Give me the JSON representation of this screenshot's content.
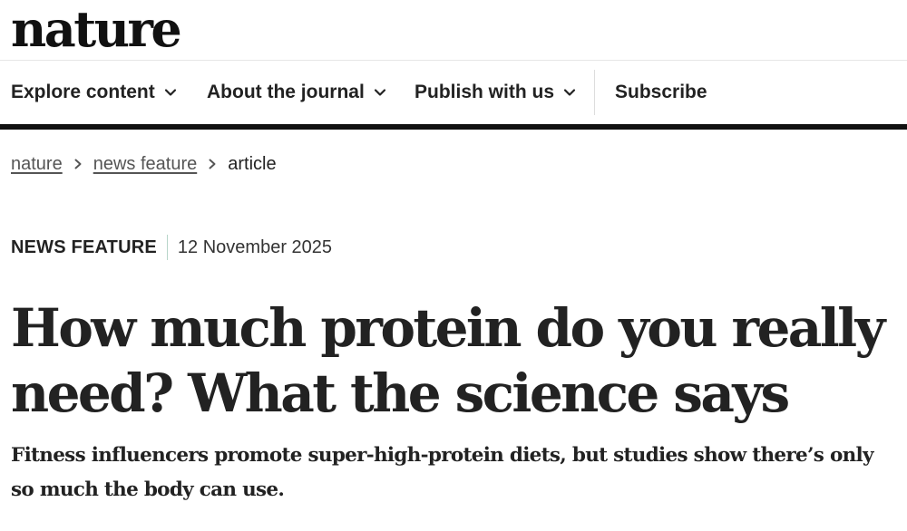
{
  "site": {
    "logo_text": "nature"
  },
  "nav": {
    "items": [
      {
        "label": "Explore content",
        "icon": "chevron-down-icon"
      },
      {
        "label": "About the journal",
        "icon": "chevron-down-icon"
      },
      {
        "label": "Publish with us",
        "icon": "chevron-down-icon"
      }
    ],
    "subscribe_label": "Subscribe"
  },
  "breadcrumb": {
    "items": [
      "nature",
      "news feature",
      "article"
    ],
    "separator_icon": "chevron-right-icon"
  },
  "article": {
    "type": "NEWS FEATURE",
    "date": "12 November 2025",
    "title": "How much protein do you really need? What the science says",
    "standfirst": "Fitness influencers promote super-high-protein diets, but studies show there’s only so much the body can use."
  },
  "colors": {
    "text": "#222222",
    "nav_bar": "#111111",
    "meta_divider": "#b7d5c9",
    "breadcrumb_link": "#555555"
  }
}
